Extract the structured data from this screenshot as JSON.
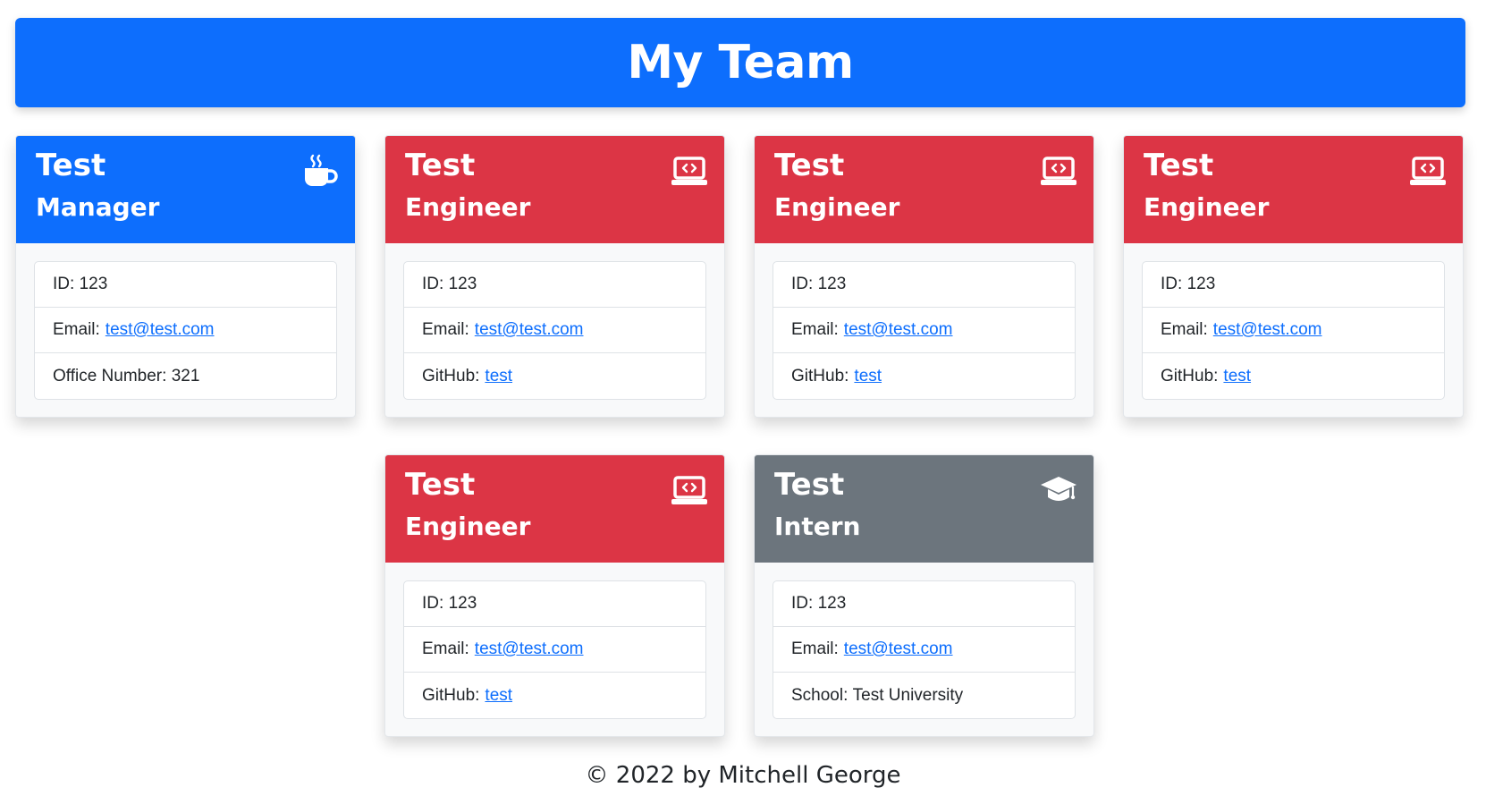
{
  "header": {
    "title": "My Team",
    "color": "#0d6efd"
  },
  "colors": {
    "manager": "#0d6efd",
    "engineer": "#dc3545",
    "intern": "#6c757d",
    "link": "#0d6efd"
  },
  "cards": [
    {
      "name": "Test",
      "role": "Manager",
      "icon": "coffee-icon",
      "id_label": "ID:",
      "id": "123",
      "email_label": "Email:",
      "email": "test@test.com",
      "extra_label": "Office Number:",
      "extra": "321"
    },
    {
      "name": "Test",
      "role": "Engineer",
      "icon": "laptop-code-icon",
      "id_label": "ID:",
      "id": "123",
      "email_label": "Email:",
      "email": "test@test.com",
      "extra_label": "GitHub:",
      "extra": "test"
    },
    {
      "name": "Test",
      "role": "Engineer",
      "icon": "laptop-code-icon",
      "id_label": "ID:",
      "id": "123",
      "email_label": "Email:",
      "email": "test@test.com",
      "extra_label": "GitHub:",
      "extra": "test"
    },
    {
      "name": "Test",
      "role": "Engineer",
      "icon": "laptop-code-icon",
      "id_label": "ID:",
      "id": "123",
      "email_label": "Email:",
      "email": "test@test.com",
      "extra_label": "GitHub:",
      "extra": "test"
    },
    {
      "name": "Test",
      "role": "Engineer",
      "icon": "laptop-code-icon",
      "id_label": "ID:",
      "id": "123",
      "email_label": "Email:",
      "email": "test@test.com",
      "extra_label": "GitHub:",
      "extra": "test"
    },
    {
      "name": "Test",
      "role": "Intern",
      "icon": "graduation-cap-icon",
      "id_label": "ID:",
      "id": "123",
      "email_label": "Email:",
      "email": "test@test.com",
      "extra_label": "School:",
      "extra": "Test University"
    }
  ],
  "footer": {
    "text": "© 2022 by Mitchell George"
  }
}
